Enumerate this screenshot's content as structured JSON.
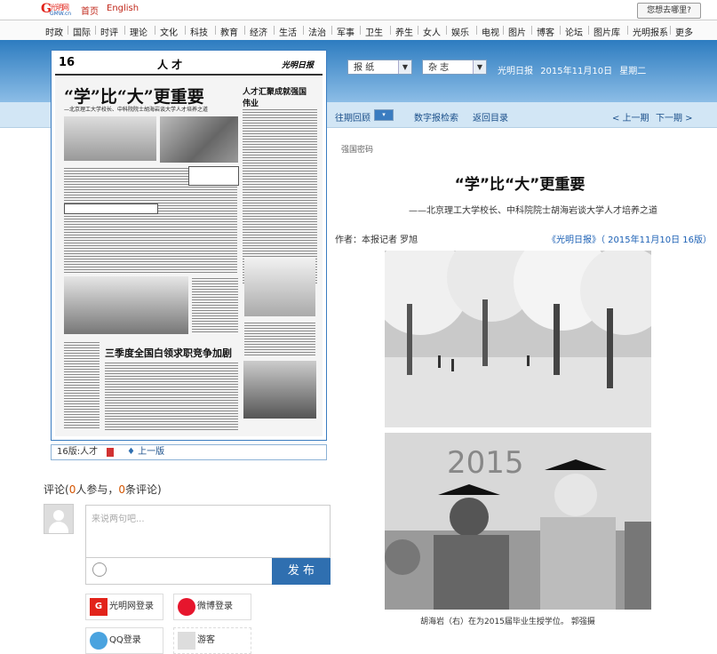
{
  "header": {
    "logo_text": "光明网",
    "logo_sub": "GMW.cn",
    "home_link": "首页",
    "english_link": "English",
    "where_button": "您想去哪里?"
  },
  "nav": {
    "items": [
      "时政",
      "国际",
      "时评",
      "理论",
      "文化",
      "科技",
      "教育",
      "经济",
      "生活",
      "法治",
      "军事",
      "卫生",
      "养生",
      "女人",
      "娱乐",
      "电视",
      "图片",
      "博客",
      "论坛",
      "图片库",
      "光明报系",
      "更多"
    ]
  },
  "toolbar": {
    "select1": "报 纸",
    "select2": "杂 志",
    "paper_name": "光明日报",
    "date": "2015年11月10日",
    "weekday": "星期二"
  },
  "subbar": {
    "past_review": "往期回顾",
    "past_icon_label": "▾",
    "digital_search": "数字报检索",
    "back_to_index": "返回目录",
    "prev_issue": "< 上一期",
    "next_issue": "下一期 >"
  },
  "newspaper_page": {
    "page_number": "16",
    "section": "人 才",
    "paper_logo": "光明日报",
    "headline": "“学”比“大”更重要",
    "sub_headline": "—北京理工大学校长、中科院院士胡海岩谈大学人才培养之道",
    "side_title": "人才汇聚成就强国伟业",
    "bottom_headline": "三季度全国白领求职竞争加剧"
  },
  "page_nav": {
    "page_label": "16版:人才",
    "prev_page": "上一版"
  },
  "article": {
    "tag": "强国密码",
    "title": "“学”比“大”更重要",
    "subtitle": "——北京理工大学校长、中科院院士胡海岩谈大学人才培养之道",
    "author": "作者：本报记者 罗旭",
    "source": "《光明日报》（ 2015年11月10日 16版）",
    "caption": "胡海岩（右）在为2015届毕业生授学位。 郭强摄"
  },
  "comments": {
    "label_prefix": "评论(",
    "participants": "0",
    "label_mid1": "人参与，",
    "count": "0",
    "label_mid2": "条评论)",
    "placeholder": "来说两句吧...",
    "publish": "发 布",
    "login_gmw": "光明网登录",
    "login_weibo": "微博登录",
    "login_qq": "QQ登录",
    "guest": "游客"
  },
  "colors": {
    "brand_red": "#e2231a",
    "brand_blue": "#2f6fb0",
    "link_blue": "#1a5fb4"
  }
}
